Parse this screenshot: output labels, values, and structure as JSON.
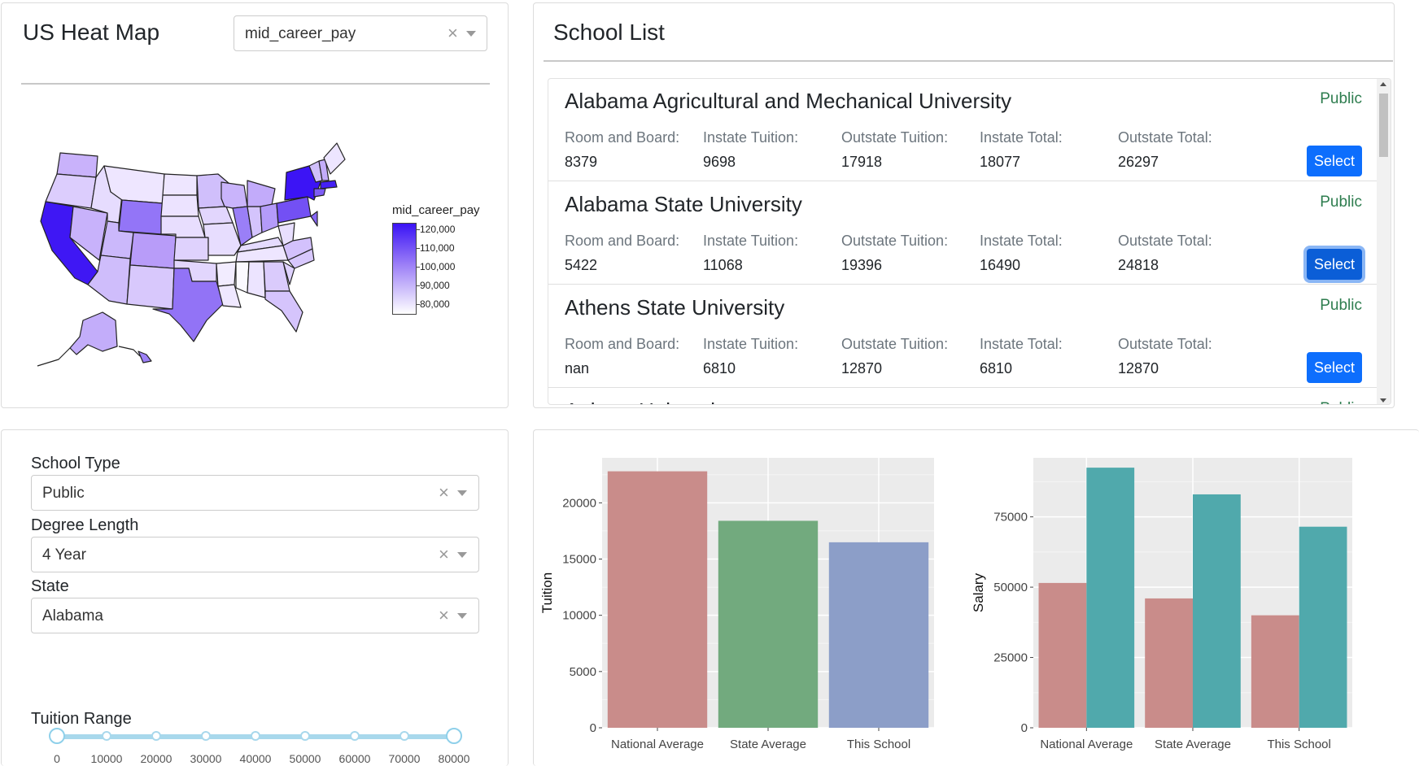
{
  "heatmap": {
    "title": "US Heat Map",
    "metric_selected": "mid_career_pay",
    "clear_glyph": "×",
    "legend_title": "mid_career_pay",
    "legend_ticks": [
      "120,000",
      "110,000",
      "100,000",
      "90,000",
      "80,000"
    ],
    "colors": {
      "low": "#ffffff",
      "high": "#3a13f5"
    }
  },
  "school_list": {
    "title": "School List",
    "field_labels": [
      "Room and Board:",
      "Instate Tuition:",
      "Outstate Tuition:",
      "Instate Total:",
      "Outstate Total:"
    ],
    "select_label": "Select",
    "schools": [
      {
        "name": "Alabama Agricultural and Mechanical University",
        "type": "Public",
        "values": [
          "8379",
          "9698",
          "17918",
          "18077",
          "26297"
        ]
      },
      {
        "name": "Alabama State University",
        "type": "Public",
        "values": [
          "5422",
          "11068",
          "19396",
          "16490",
          "24818"
        ]
      },
      {
        "name": "Athens State University",
        "type": "Public",
        "values": [
          "nan",
          "6810",
          "12870",
          "6810",
          "12870"
        ]
      },
      {
        "name": "Auburn University",
        "type": "Public",
        "values": [
          "",
          "",
          "",
          "",
          ""
        ]
      }
    ]
  },
  "filters": {
    "school_type": {
      "label": "School Type",
      "value": "Public"
    },
    "degree_length": {
      "label": "Degree Length",
      "value": "4 Year"
    },
    "state": {
      "label": "State",
      "value": "Alabama"
    },
    "clear_glyph": "×",
    "tuition_range": {
      "label": "Tuition Range",
      "marks": [
        "0",
        "10000",
        "20000",
        "30000",
        "40000",
        "50000",
        "60000",
        "70000",
        "80000"
      ],
      "min": 0,
      "max": 80000,
      "selected": [
        0,
        80000
      ]
    }
  },
  "chart_data": [
    {
      "type": "bar",
      "title": "",
      "xlabel": "",
      "ylabel": "Tuition",
      "categories": [
        "National Average",
        "State Average",
        "This School"
      ],
      "values": [
        22800,
        18400,
        16490
      ],
      "bar_colors": [
        "#c98c8a",
        "#72aa7e",
        "#8c9ec8"
      ],
      "ylim": [
        0,
        24000
      ],
      "yticks": [
        0,
        5000,
        10000,
        15000,
        20000
      ],
      "grid": true
    },
    {
      "type": "bar",
      "title": "",
      "xlabel": "",
      "ylabel": "Salary",
      "categories": [
        "National Average",
        "State Average",
        "This School"
      ],
      "series": [
        {
          "values": [
            51500,
            46000,
            40000
          ],
          "color": "#c98c8a"
        },
        {
          "values": [
            92500,
            83000,
            71500
          ],
          "color": "#50a9ac"
        }
      ],
      "ylim": [
        0,
        96000
      ],
      "yticks": [
        0,
        25000,
        50000,
        75000
      ],
      "grid": true
    }
  ]
}
